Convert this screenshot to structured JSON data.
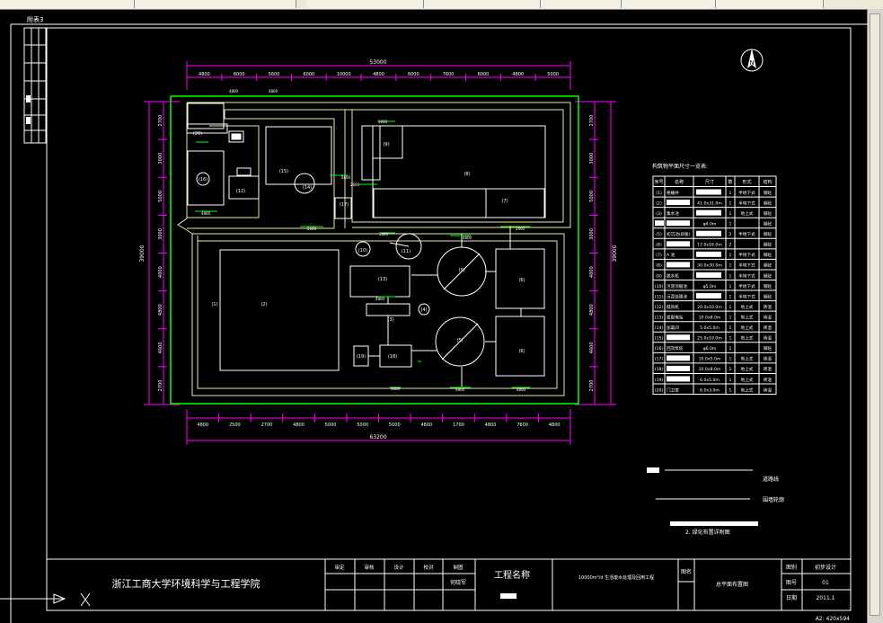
{
  "window": {
    "tabs": [
      "",
      "",
      "",
      "",
      "",
      "",
      ""
    ],
    "top_left_label": "附表3"
  },
  "north_label": "N",
  "drawing": {
    "top_total": "53000",
    "bottom_total": "63200",
    "left_total": "39000",
    "right_total": "39000",
    "top_segments": [
      "4800",
      "6000",
      "5600",
      "6000",
      "10000",
      "4800",
      "6000",
      "7600",
      "6000",
      "4800",
      "5000"
    ],
    "bottom_segments": [
      "4800",
      "2500",
      "2700",
      "4800",
      "5000",
      "5000",
      "5000",
      "4800",
      "1700",
      "4800",
      "7600",
      "4800"
    ],
    "left_segments": [
      "2700",
      "3000",
      "5000",
      "3000",
      "4000",
      "4800",
      "4600",
      "2700"
    ],
    "right_segments": [
      "2700",
      "3000",
      "5000",
      "3000",
      "4000",
      "4800",
      "4600",
      "2700"
    ],
    "units": [
      {
        "id": "u1",
        "label": "(1)"
      },
      {
        "id": "u2",
        "label": "(2)"
      },
      {
        "id": "u3",
        "label": "(3)"
      },
      {
        "id": "u4",
        "label": "(4)"
      },
      {
        "id": "u5a",
        "label": "(5)"
      },
      {
        "id": "u5b",
        "label": "(5)"
      },
      {
        "id": "u6a",
        "label": "(6)"
      },
      {
        "id": "u6b",
        "label": "(6)"
      },
      {
        "id": "u7",
        "label": "(7)"
      },
      {
        "id": "u8",
        "label": "(8)"
      },
      {
        "id": "u9",
        "label": "(9)"
      },
      {
        "id": "u10",
        "label": "(10)"
      },
      {
        "id": "u11",
        "label": "(11)"
      },
      {
        "id": "u12",
        "label": "(12)"
      },
      {
        "id": "u13",
        "label": "(13)"
      },
      {
        "id": "u14",
        "label": "(14)"
      },
      {
        "id": "u15",
        "label": "(15)"
      },
      {
        "id": "u16",
        "label": "(16)"
      },
      {
        "id": "u17",
        "label": "(17)"
      },
      {
        "id": "u18",
        "label": "(18)"
      },
      {
        "id": "u19",
        "label": "(19)"
      },
      {
        "id": "u20",
        "label": "(20)"
      }
    ],
    "inner_dims": [
      "4800",
      "4800",
      "4800",
      "2600",
      "3600",
      "2600",
      "5600",
      "2600",
      "3000",
      "5600",
      "4800",
      "4800",
      "4800",
      "4800"
    ]
  },
  "table": {
    "title": "构筑物平面尺寸一览表:",
    "headers": [
      "序号",
      "名称",
      "尺寸",
      "数",
      "形式",
      "结构"
    ],
    "rows": [
      [
        "(1)",
        "格栅井",
        "",
        "1",
        "半地下式",
        "钢砼"
      ],
      [
        "(2)",
        "",
        "41.0x31.0m",
        "1",
        "半地下式",
        "钢砼"
      ],
      [
        "(3)",
        "集水池",
        "",
        "1",
        "地上式",
        "钢砼"
      ],
      [
        "",
        "",
        "φ4.0m",
        "1",
        "",
        "钢砼"
      ],
      [
        "(5)",
        "初沉池(斜板)",
        "",
        "2",
        "半地下式",
        "钢砼"
      ],
      [
        "(6)",
        "",
        "17.0x16.0m",
        "2",
        "",
        "钢砼"
      ],
      [
        "(7)",
        "A 池",
        "",
        "1",
        "半地下式",
        "钢砼"
      ],
      [
        "(8)",
        "",
        "30.0x30.0m",
        "1",
        "半地下式",
        "钢砼"
      ],
      [
        "(9)",
        "脱水机",
        "",
        "1",
        "半地下式",
        "钢砼"
      ],
      [
        "(10)",
        "污泥浓缩池",
        "φ5.0m",
        "1",
        "半地下式",
        "钢砼"
      ],
      [
        "(11)",
        "污泥处理池",
        "",
        "1",
        "半地下式",
        "钢砼"
      ],
      [
        "(12)",
        "鼓风机",
        "20.0x10.0m",
        "1",
        "地上式",
        "砖混"
      ],
      [
        "(13)",
        "变配电站",
        "10.0x8.0m",
        "1",
        "地上式",
        "砖混"
      ],
      [
        "(14)",
        "加氯间",
        "5.0x5.0m",
        "1",
        "地上式",
        "砖混"
      ],
      [
        "(15)",
        "",
        "25.0x10.0m",
        "1",
        "地上式",
        "砖混"
      ],
      [
        "(16)",
        "回流泵房",
        "φ6.0m",
        "1",
        "",
        "钢砼"
      ],
      [
        "(17)",
        "",
        "10.0x5.0m",
        "1",
        "地上式",
        "砖混"
      ],
      [
        "(18)",
        "",
        "10.0x8.0m",
        "1",
        "地上式",
        "砖混"
      ],
      [
        "(19)",
        "",
        "6.0x5.0m",
        "1",
        "地上式",
        "砖混"
      ],
      [
        "(20)",
        "门卫室",
        "6.0x3.0m",
        "1",
        "地上式",
        "砖混"
      ]
    ]
  },
  "legend": {
    "item1": "道路线",
    "item2": "围墙轮廓",
    "note": "2. 绿化布置详附图"
  },
  "title_block": {
    "school": "浙江工商大学环境科学与工程学院",
    "headers": [
      "审定",
      "审核",
      "设计",
      "校对",
      "制图"
    ],
    "drawer": "何晓军",
    "project_label": "工程名称",
    "project_name": "10000m³/d 生活废水处理及回用工程",
    "drawing_label": "图名",
    "drawing_name": "总平面布置图",
    "right_labels": [
      "图别",
      "图号",
      "日期"
    ],
    "right_values": [
      "初步设计",
      "01",
      "2011.1"
    ],
    "sheet_size": "A2: 420x594"
  },
  "colors": {
    "white": "#ffffff",
    "magenta": "#ff00ff",
    "green": "#00ff00",
    "yellow": "#ffff66",
    "cyan": "#00ffff"
  }
}
